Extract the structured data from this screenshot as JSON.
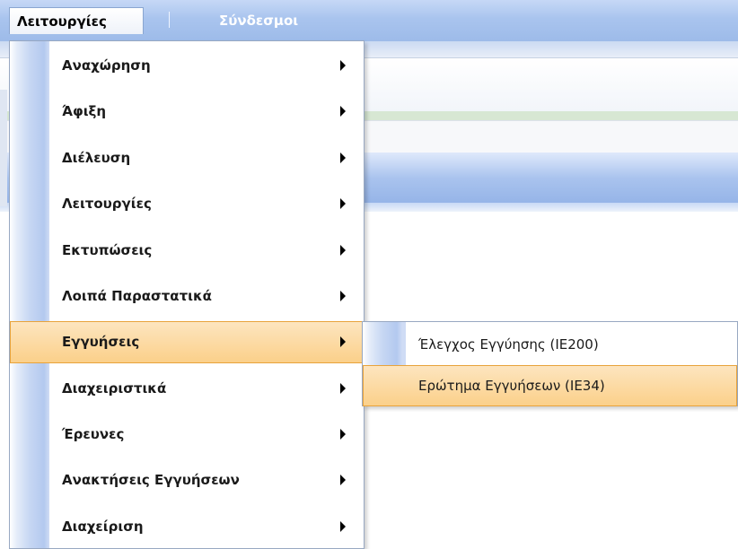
{
  "menubar": {
    "items": [
      {
        "label": "Λειτουργίες"
      },
      {
        "label": "Σύνδεσμοι"
      }
    ]
  },
  "dropdown": {
    "items": [
      {
        "label": "Αναχώρηση"
      },
      {
        "label": "Άφιξη"
      },
      {
        "label": "Διέλευση"
      },
      {
        "label": "Λειτουργίες"
      },
      {
        "label": "Εκτυπώσεις"
      },
      {
        "label": "Λοιπά Παραστατικά"
      },
      {
        "label": "Εγγυήσεις"
      },
      {
        "label": "Διαχειριστικά"
      },
      {
        "label": "Έρευνες"
      },
      {
        "label": "Ανακτήσεις Εγγυήσεων"
      },
      {
        "label": "Διαχείριση"
      }
    ],
    "highlighted_index": 6
  },
  "submenu": {
    "items": [
      {
        "label": "Έλεγχος Εγγύησης (IE200)"
      },
      {
        "label": "Ερώτημα Εγγυήσεων (IE34)"
      }
    ],
    "highlighted_index": 1
  },
  "colors": {
    "menubar": "#a9c4ee",
    "highlight_fill": "#fbd08a",
    "highlight_border": "#e8a33b",
    "gutter": "#b3c9ef"
  },
  "icons": {
    "submenu_arrow": "triangle-right-icon"
  }
}
